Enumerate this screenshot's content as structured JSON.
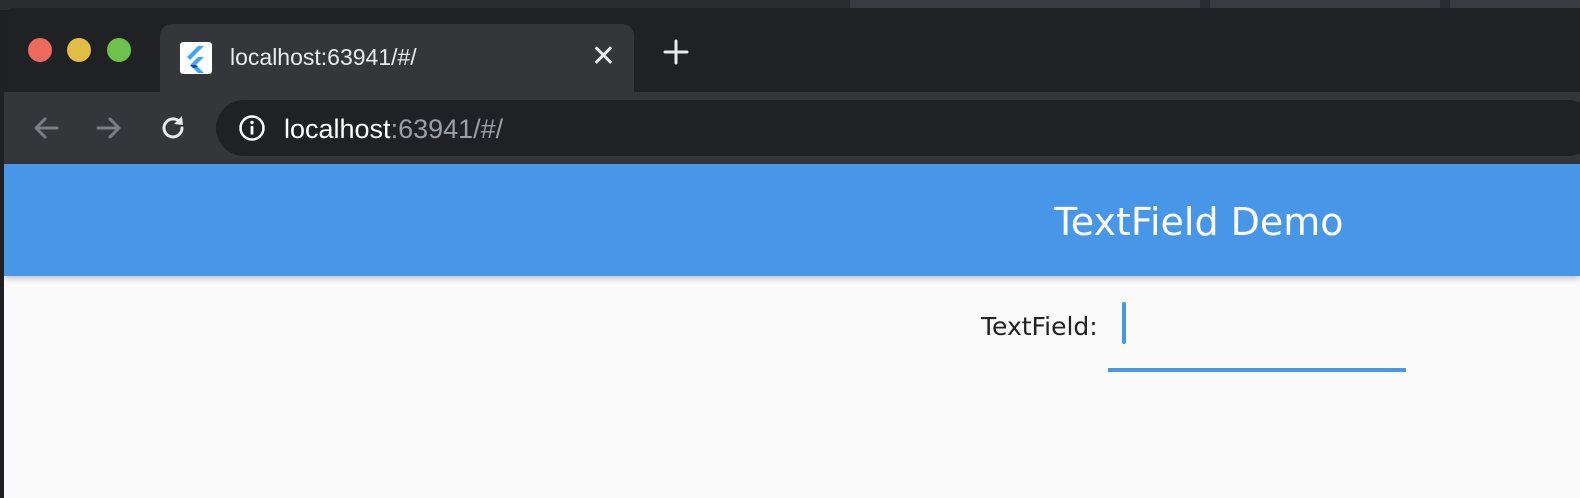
{
  "browser": {
    "tab": {
      "title": "localhost:63941/#/",
      "close_label": "✕"
    },
    "address_bar": {
      "host": "localhost",
      "path": ":63941/#/"
    }
  },
  "app": {
    "title": "TextField Demo",
    "accent_color": "#4796e8",
    "text_field": {
      "label": "TextField:",
      "value": ""
    }
  },
  "icons": [
    "flutter-favicon-icon",
    "close-icon",
    "plus-icon",
    "back-arrow-icon",
    "forward-arrow-icon",
    "reload-icon",
    "info-icon"
  ]
}
